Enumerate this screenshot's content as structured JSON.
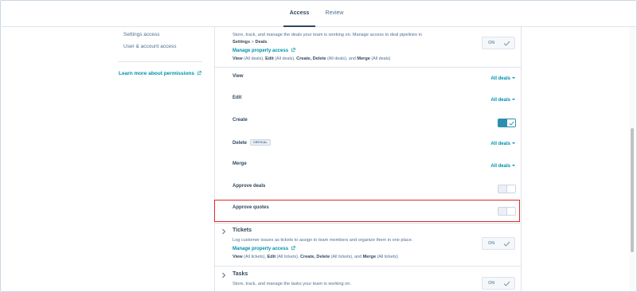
{
  "tabs": [
    {
      "label": "Access",
      "active": true
    },
    {
      "label": "Review",
      "active": false
    }
  ],
  "leftnav": {
    "items": [
      "Settings access",
      "User & account access"
    ],
    "learn_more": "Learn more about permissions"
  },
  "deals": {
    "description_line1": "Store, track, and manage the deals your team is working on. Manage access to deal pipelines in",
    "description_settings": "Settings",
    "description_sep": " > ",
    "description_deals": "Deals",
    "description_end": ".",
    "manage_property_access": "Manage property access",
    "summary": {
      "view": "View",
      "view_scope": "(All deals),",
      "edit": "Edit",
      "edit_scope": "(All deals),",
      "create": "Create,",
      "delete": "Delete",
      "delete_scope": "(All deals),",
      "and": "and",
      "merge": "Merge",
      "merge_scope": "(All deals)"
    },
    "on_label": "ON",
    "permissions": [
      {
        "label": "View",
        "control": "dropdown",
        "value": "All deals"
      },
      {
        "label": "Edit",
        "control": "dropdown",
        "value": "All deals"
      },
      {
        "label": "Create",
        "control": "toggle",
        "checked": true
      },
      {
        "label": "Delete",
        "badge": "CRITICAL",
        "control": "dropdown",
        "value": "All deals"
      },
      {
        "label": "Merge",
        "control": "dropdown",
        "value": "All deals"
      },
      {
        "label": "Approve deals",
        "control": "toggle",
        "checked": false
      },
      {
        "label": "Approve quotes",
        "control": "toggle",
        "checked": false
      }
    ]
  },
  "tickets": {
    "title": "Tickets",
    "description": "Log customer issues as tickets to assign to team members and organize them in one place.",
    "manage_property_access": "Manage property access",
    "summary": {
      "view": "View",
      "view_scope": "(All tickets),",
      "edit": "Edit",
      "edit_scope": "(All tickets),",
      "create": "Create,",
      "delete": "Delete",
      "delete_scope": "(All tickets),",
      "and": "and",
      "merge": "Merge",
      "merge_scope": "(All tickets)"
    },
    "on_label": "ON"
  },
  "tasks": {
    "title": "Tasks",
    "description": "Store, track, and manage the tasks your team is working on.",
    "on_label": "ON"
  },
  "colors": {
    "accent": "#0091ae",
    "toggle_on": "#2d8fae",
    "highlight": "#e0292b"
  }
}
